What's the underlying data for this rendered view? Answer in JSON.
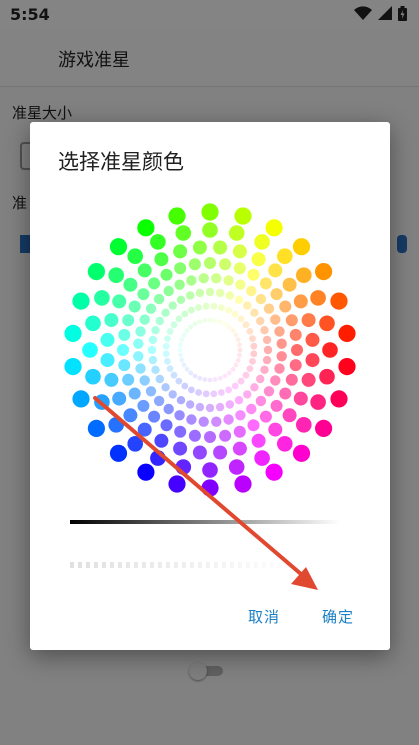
{
  "status_bar": {
    "time": "5:54",
    "icons": [
      "wifi-icon",
      "cell-signal-icon",
      "battery-icon"
    ]
  },
  "app_bar": {
    "title": "游戏准星"
  },
  "settings": {
    "size_label": "准星大小",
    "color_label_partial": "准"
  },
  "dialog": {
    "title": "选择准星颜色",
    "cancel_label": "取消",
    "ok_label": "确定"
  },
  "colors": {
    "accent": "#1a7fc4",
    "annotation_arrow": "#e0492f",
    "slider_blue": "#2b6fbf"
  }
}
